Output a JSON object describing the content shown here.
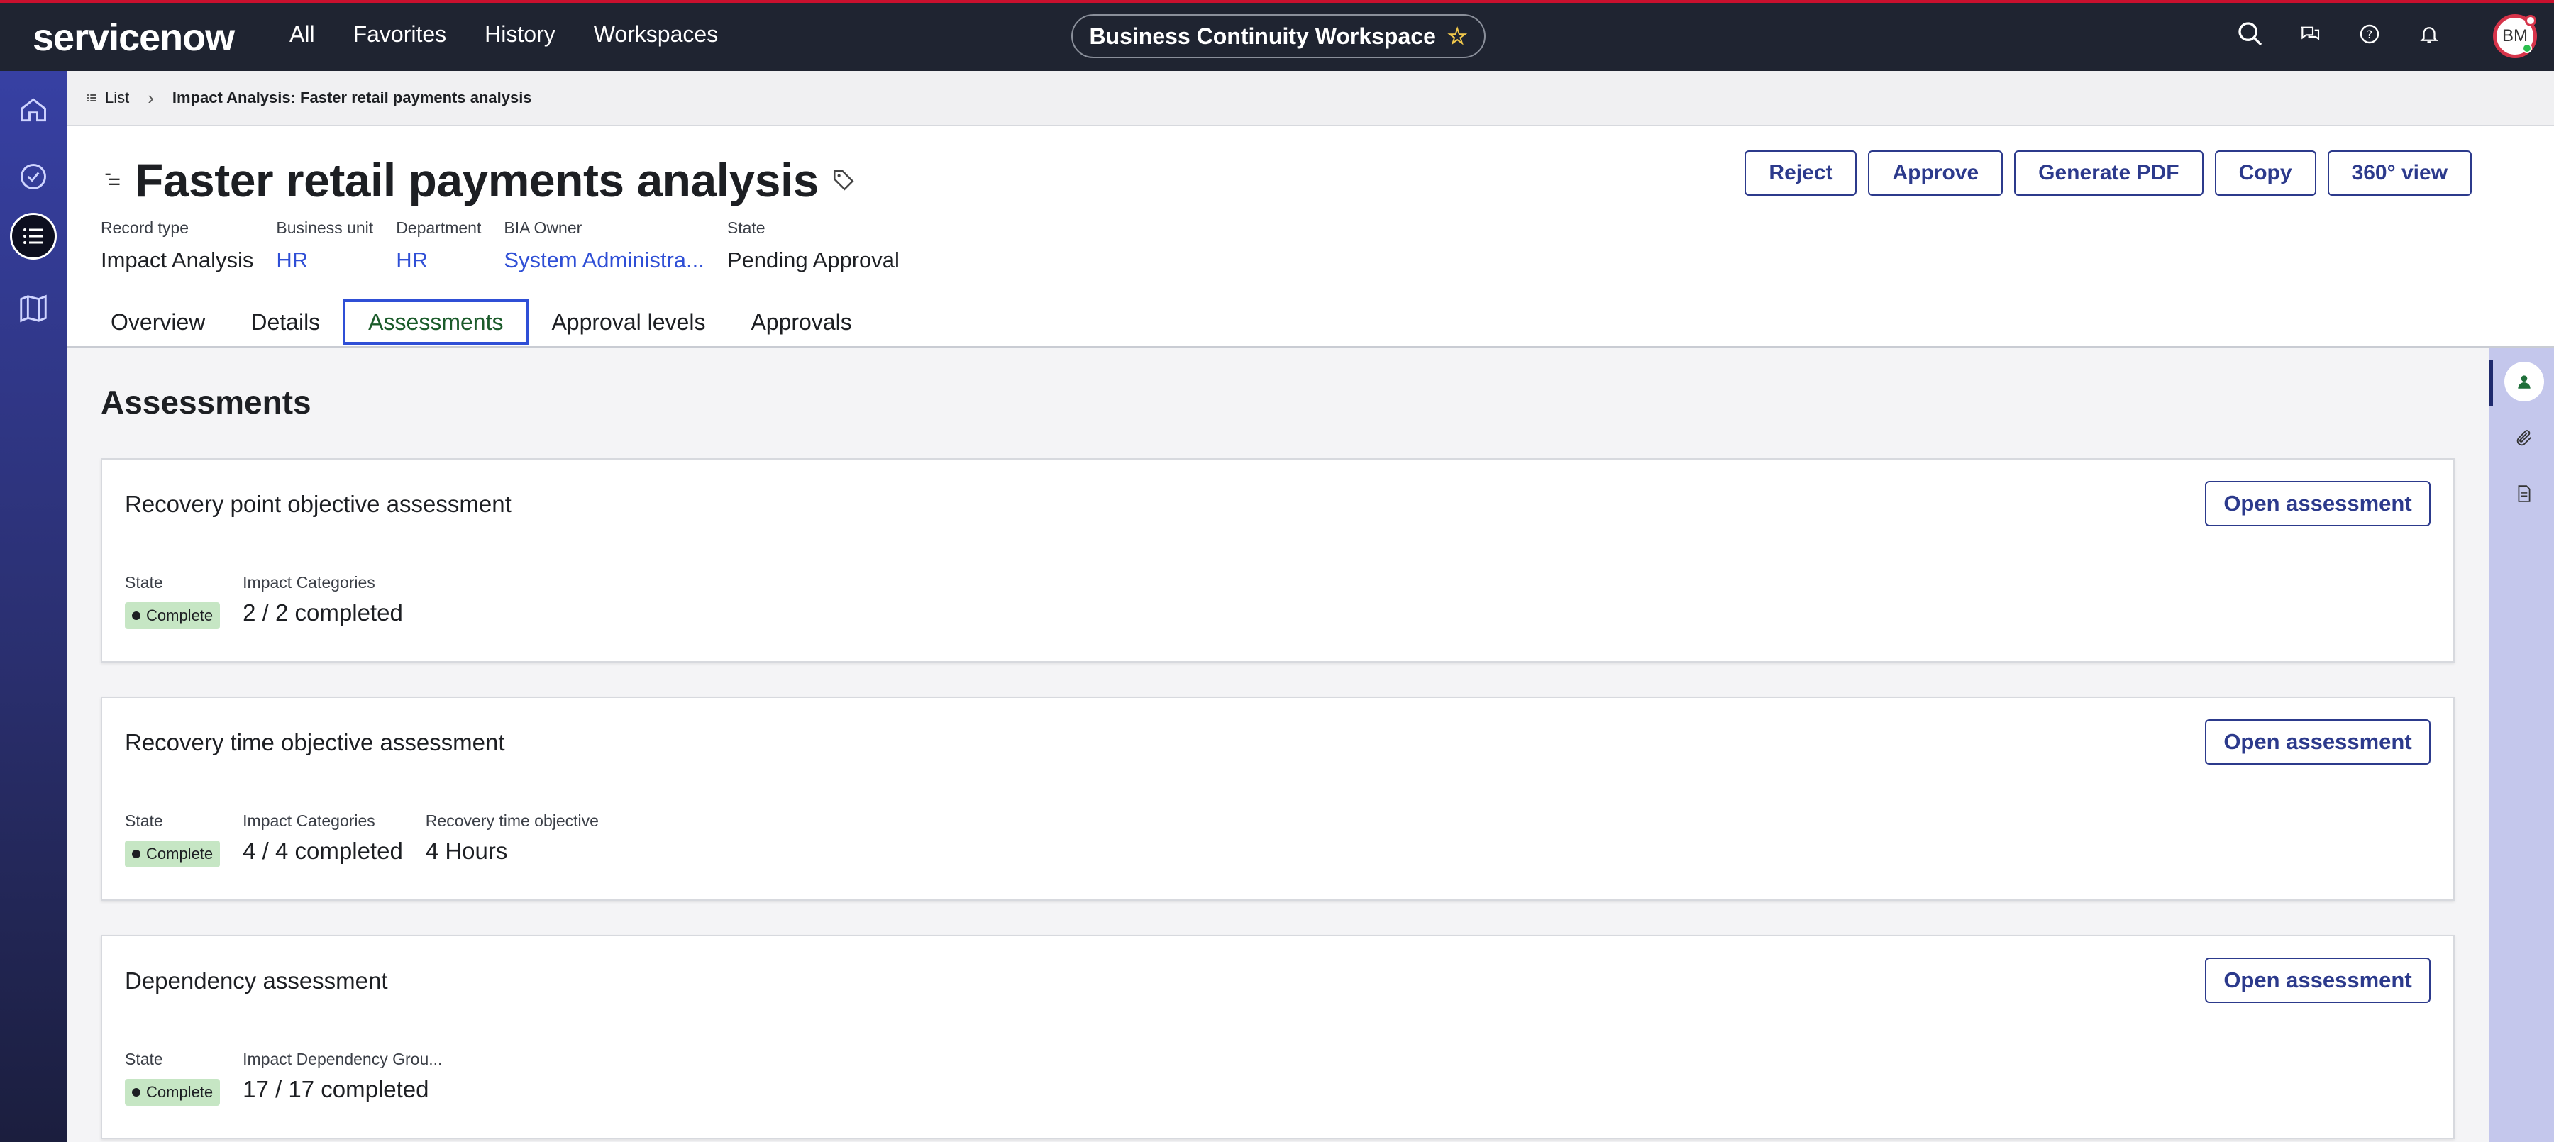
{
  "topnav": {
    "logo": "servicenow",
    "menu": [
      "All",
      "Favorites",
      "History",
      "Workspaces"
    ],
    "workspace": "Business Continuity Workspace",
    "avatar_initials": "BM"
  },
  "breadcrumb": {
    "list_label": "List",
    "current": "Impact Analysis: Faster retail payments analysis"
  },
  "record": {
    "title": "Faster retail payments analysis",
    "actions": [
      "Reject",
      "Approve",
      "Generate PDF",
      "Copy",
      "360° view"
    ],
    "meta": [
      {
        "label": "Record type",
        "value": "Impact Analysis",
        "link": false
      },
      {
        "label": "Business unit",
        "value": "HR",
        "link": true
      },
      {
        "label": "Department",
        "value": "HR",
        "link": true
      },
      {
        "label": "BIA Owner",
        "value": "System Administra...",
        "link": true
      },
      {
        "label": "State",
        "value": "Pending Approval",
        "link": false
      }
    ],
    "tabs": [
      "Overview",
      "Details",
      "Assessments",
      "Approval levels",
      "Approvals"
    ],
    "active_tab": "Assessments"
  },
  "assessments": {
    "heading": "Assessments",
    "open_label": "Open assessment",
    "cards": [
      {
        "title": "Recovery point objective assessment",
        "fields": [
          {
            "label": "State",
            "value": "Complete",
            "badge": true
          },
          {
            "label": "Impact Categories",
            "value": "2 / 2 completed"
          }
        ]
      },
      {
        "title": "Recovery time objective assessment",
        "fields": [
          {
            "label": "State",
            "value": "Complete",
            "badge": true
          },
          {
            "label": "Impact Categories",
            "value": "4 / 4 completed"
          },
          {
            "label": "Recovery time objective",
            "value": "4 Hours"
          }
        ]
      },
      {
        "title": "Dependency assessment",
        "fields": [
          {
            "label": "State",
            "value": "Complete",
            "badge": true
          },
          {
            "label": "Impact Dependency Grou...",
            "value": "17 / 17 completed"
          }
        ]
      }
    ]
  },
  "colors": {
    "topbar": "#1f2431",
    "accent": "#2c3a8c",
    "link": "#2f4fd6",
    "complete_badge": "#c6e6c4"
  }
}
